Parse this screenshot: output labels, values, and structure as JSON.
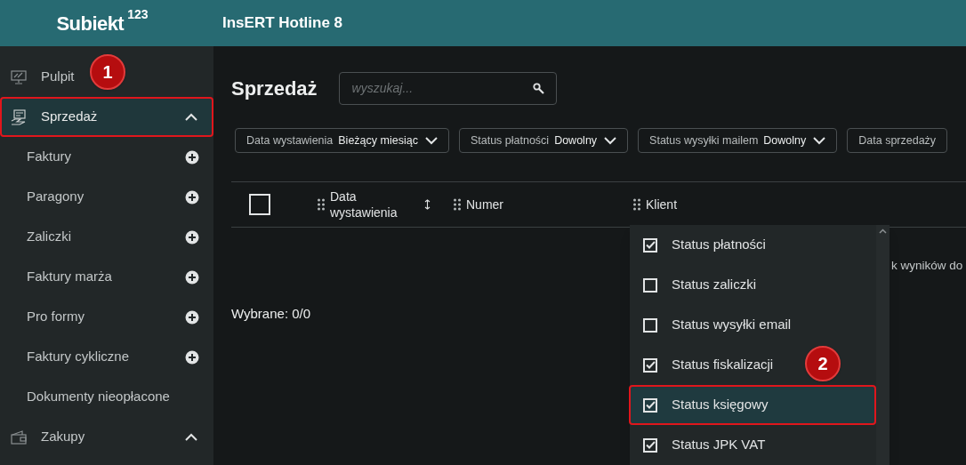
{
  "header": {
    "logo": "Subiekt",
    "logo_sup": "123",
    "company": "InsERT Hotline 8"
  },
  "sidebar": {
    "sections": [
      {
        "label": "Pulpit",
        "selected": false,
        "highlighted": false
      },
      {
        "label": "Sprzedaż",
        "selected": true,
        "highlighted": true,
        "expanded": true,
        "children": [
          {
            "label": "Faktury",
            "add": true
          },
          {
            "label": "Paragony",
            "add": true
          },
          {
            "label": "Zaliczki",
            "add": true
          },
          {
            "label": "Faktury marża",
            "add": true
          },
          {
            "label": "Pro formy",
            "add": true
          },
          {
            "label": "Faktury cykliczne",
            "add": true
          },
          {
            "label": "Dokumenty nieopłacone",
            "add": false
          }
        ]
      },
      {
        "label": "Zakupy",
        "selected": false,
        "highlighted": false,
        "expanded": true
      }
    ]
  },
  "main": {
    "title": "Sprzedaż",
    "search": {
      "placeholder": "wyszukaj..."
    },
    "filters": [
      {
        "label": "Data wystawienia",
        "value": "Bieżący miesiąc"
      },
      {
        "label": "Status płatności",
        "value": "Dowolny"
      },
      {
        "label": "Status wysyłki mailem",
        "value": "Dowolny"
      },
      {
        "label": "Data sprzedaży"
      }
    ],
    "table": {
      "select_all": {
        "checked": false
      },
      "columns": [
        {
          "label": "Data wystawienia",
          "sortable": true
        },
        {
          "label": "Numer",
          "sortable": false
        },
        {
          "label": "Klient",
          "sortable": false
        }
      ],
      "empty_message": "k wyników do"
    },
    "selection": "Wybrane: 0/0",
    "column_menu": [
      {
        "label": "Status płatności",
        "checked": true,
        "highlighted": false
      },
      {
        "label": "Status zaliczki",
        "checked": false,
        "highlighted": false
      },
      {
        "label": "Status wysyłki email",
        "checked": false,
        "highlighted": false
      },
      {
        "label": "Status fiskalizacji",
        "checked": true,
        "highlighted": false
      },
      {
        "label": "Status księgowy",
        "checked": true,
        "highlighted": true
      },
      {
        "label": "Status JPK VAT",
        "checked": true,
        "highlighted": false
      }
    ]
  },
  "annotations": [
    {
      "label": "1"
    },
    {
      "label": "2"
    }
  ]
}
